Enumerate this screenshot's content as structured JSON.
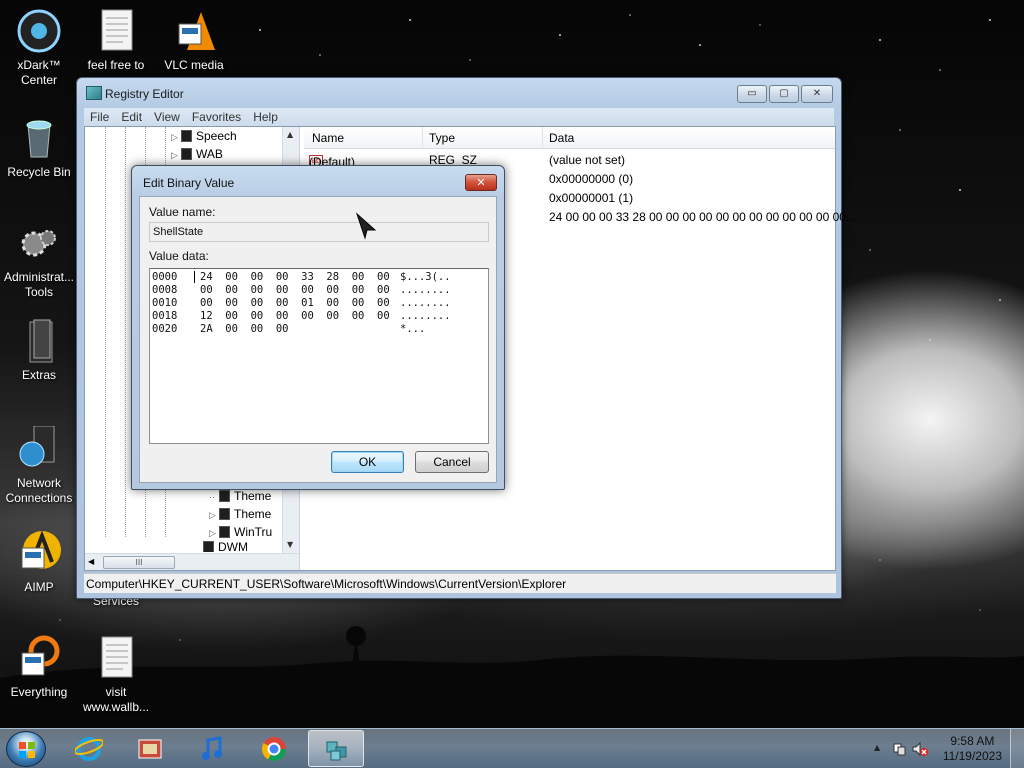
{
  "desktop": {
    "icons": [
      {
        "label": "xDark™ Center",
        "line1": "xDark™",
        "line2": "Center"
      },
      {
        "label": "feel free to",
        "line1": "feel free to",
        "line2": ""
      },
      {
        "label": "VLC media",
        "line1": "VLC media",
        "line2": ""
      },
      {
        "label": "Recycle Bin",
        "line1": "Recycle Bin",
        "line2": ""
      },
      {
        "label": "Administrative Tools",
        "line1": "Administrat...",
        "line2": "Tools"
      },
      {
        "label": "Extras",
        "line1": "Extras",
        "line2": ""
      },
      {
        "label": "Network Connections",
        "line1": "Network",
        "line2": "Connections"
      },
      {
        "label": "AIMP",
        "line1": "AIMP",
        "line2": ""
      },
      {
        "label": "Everything",
        "line1": "Everything",
        "line2": ""
      },
      {
        "label": "visit www.wallb...",
        "line1": "visit",
        "line2": "www.wallb..."
      }
    ],
    "partial_label": "Services"
  },
  "regedit": {
    "title": "Registry Editor",
    "menu": [
      "File",
      "Edit",
      "View",
      "Favorites",
      "Help"
    ],
    "tree": {
      "top_items": [
        "Speech",
        "WAB"
      ],
      "bottom_items": [
        "Theme",
        "Theme",
        "WinTru",
        "DWM"
      ],
      "hscroll_glyph": "III"
    },
    "columns": {
      "name": "Name",
      "type": "Type",
      "data": "Data"
    },
    "rows": [
      {
        "name": "(Default)",
        "type": "REG_SZ",
        "data": "(value not set)"
      },
      {
        "name": "",
        "type": "",
        "data": "0x00000000 (0)"
      },
      {
        "name": "",
        "type": "",
        "data": "0x00000001 (1)"
      },
      {
        "name": "",
        "type": "",
        "data": "24 00 00 00 33 28 00 00 00 00 00 00 00 00 00 00 00 00..."
      }
    ],
    "status_path": "Computer\\HKEY_CURRENT_USER\\Software\\Microsoft\\Windows\\CurrentVersion\\Explorer",
    "buttons": {
      "minimize": "▭",
      "maximize": "▢",
      "close": "✕"
    }
  },
  "dialog": {
    "title": "Edit Binary Value",
    "close": "✕",
    "value_name_label": "Value name:",
    "value_name": "ShellState",
    "value_data_label": "Value data:",
    "hex_lines": [
      {
        "offset": "0000",
        "bytes": "24  00  00  00  33  28  00  00",
        "ascii": "$...3(.."
      },
      {
        "offset": "0008",
        "bytes": "00  00  00  00  00  00  00  00",
        "ascii": "........"
      },
      {
        "offset": "0010",
        "bytes": "00  00  00  00  01  00  00  00",
        "ascii": "........"
      },
      {
        "offset": "0018",
        "bytes": "12  00  00  00  00  00  00  00",
        "ascii": "........"
      },
      {
        "offset": "0020",
        "bytes": "2A  00  00  00",
        "ascii": "*..."
      }
    ],
    "ok": "OK",
    "cancel": "Cancel"
  },
  "taskbar": {
    "clock_time": "9:58 AM",
    "clock_date": "11/19/2023",
    "tray_arrow": "▲"
  }
}
